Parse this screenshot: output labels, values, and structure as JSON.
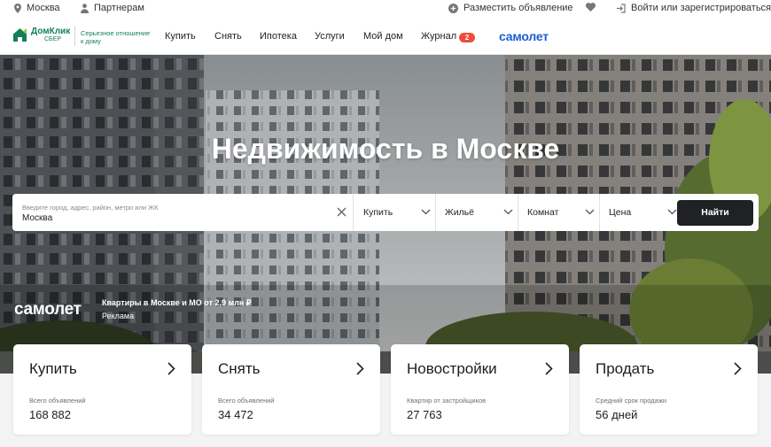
{
  "topbar": {
    "city": "Москва",
    "partners": "Партнерам",
    "post_ad": "Разместить объявление",
    "login": "Войти или зарегистрироваться"
  },
  "nav": {
    "logo_name": "ДомКлик",
    "logo_sub": "СБЕР",
    "tagline_line1": "Серьезное отношение",
    "tagline_line2": "к дому",
    "links": [
      "Купить",
      "Снять",
      "Ипотека",
      "Услуги",
      "Мой дом",
      "Журнал"
    ],
    "journal_badge": "2",
    "partner_brand": "самолет",
    "brand_color": "#12805c",
    "partner_color": "#1a5fd6"
  },
  "hero": {
    "title": "Недвижимость в Москве"
  },
  "search": {
    "placeholder": "Введите город, адрес, район, метро или ЖК",
    "value": "Москва",
    "deal": "Купить",
    "type": "Жильё",
    "rooms": "Комнат",
    "price": "Цена",
    "button": "Найти"
  },
  "ad": {
    "brand": "самолет",
    "text": "Квартиры в Москве и МО от 2,9 млн ₽",
    "label": "Реклама"
  },
  "cards": [
    {
      "title": "Купить",
      "sub": "Всего объявлений",
      "value": "168 882"
    },
    {
      "title": "Снять",
      "sub": "Всего объявлений",
      "value": "34 472"
    },
    {
      "title": "Новостройки",
      "sub": "Квартир от застройщиков",
      "value": "27 763"
    },
    {
      "title": "Продать",
      "sub": "Средний срок продажи",
      "value": "56 дней"
    }
  ]
}
